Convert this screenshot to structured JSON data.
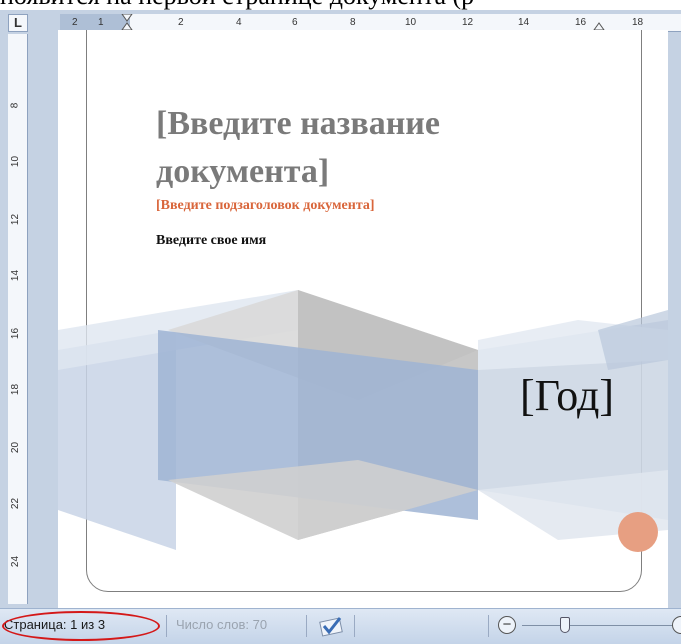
{
  "caption": "появится на первой странице документа (р",
  "ruler": {
    "corner": "L",
    "h_labels": [
      "2",
      "1",
      "2",
      "4",
      "6",
      "8",
      "10",
      "12",
      "14",
      "16",
      "18"
    ],
    "v_labels": [
      "8",
      "10",
      "12",
      "14",
      "16",
      "18",
      "20",
      "22",
      "24"
    ]
  },
  "cover": {
    "title": "[Введите название документа]",
    "subtitle": "[Введите подзаголовок документа]",
    "author": "Введите свое имя",
    "year": "[Год]"
  },
  "status_bar": {
    "page": "Страница: 1 из 3",
    "words": "Число слов: 70",
    "zoom_minus": "−"
  },
  "colors": {
    "title": "#7a7a7a",
    "subtitle": "#d9663b",
    "highlight_ring": "#d41818",
    "accent_circle": "#e79f82"
  },
  "icons": [
    "proofing-check-icon",
    "zoom-minus-icon",
    "zoom-plus-icon"
  ]
}
